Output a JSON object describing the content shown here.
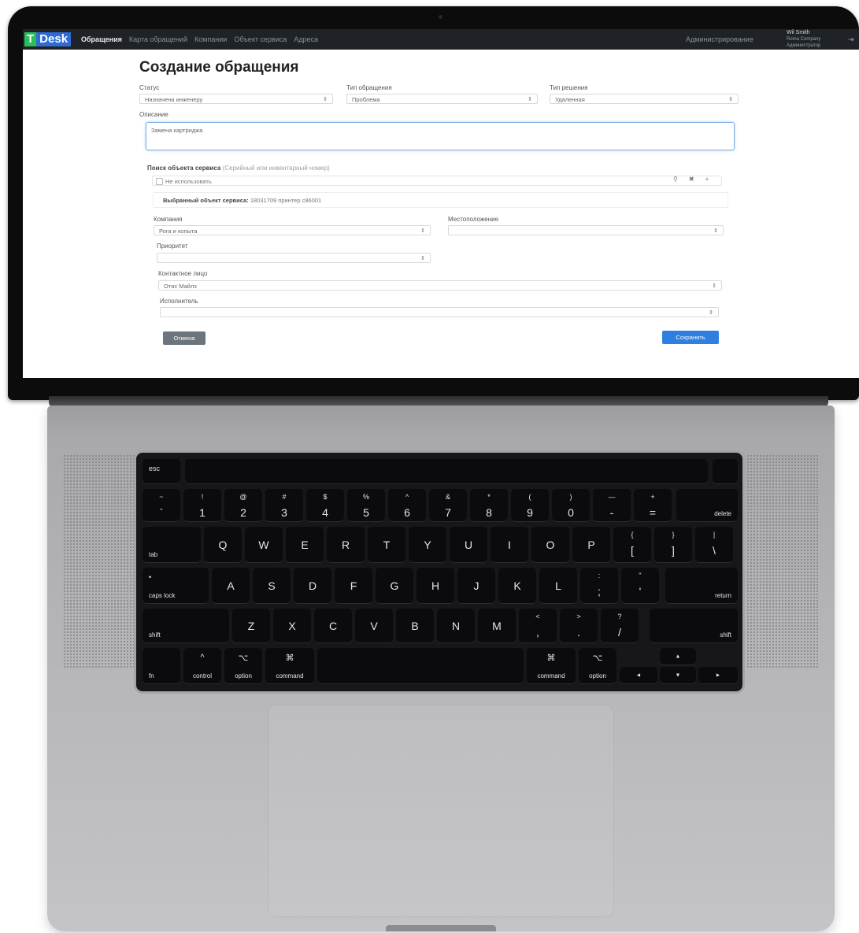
{
  "app": {
    "logo_part1": "T",
    "logo_part2": "Desk",
    "nav": [
      "Обращения",
      "Карта обращений",
      "Компании",
      "Объект сервиса",
      "Адреса"
    ],
    "admin_label": "Администрирование",
    "user_name": "Wil Smith",
    "user_company": "Roma Company",
    "user_role": "Администратор",
    "logout_icon": "logout-icon"
  },
  "form": {
    "title": "Создание обращения",
    "status": {
      "label": "Статус",
      "value": "Назначена инженеру"
    },
    "type": {
      "label": "Тип обращения",
      "value": "Проблема"
    },
    "resolution": {
      "label": "Тип решения",
      "value": "Удаленная"
    },
    "description": {
      "label": "Описание",
      "value": "Замена картриджа"
    },
    "object_search": {
      "label": "Поиск объекта сервиса",
      "hint": "(Серийный или инвентарный номер)",
      "checkbox_label": "Не использовать"
    },
    "selected_object": {
      "label": "Выбранный объект сервиса:",
      "value": "18031709 принтер c86001"
    },
    "company": {
      "label": "Компания",
      "value": "Рога и копыта"
    },
    "location": {
      "label": "Местоположение",
      "value": ""
    },
    "priority": {
      "label": "Приоритет",
      "value": ""
    },
    "contact": {
      "label": "Контактное лицо",
      "value": "Отис Майлз"
    },
    "executor": {
      "label": "Исполнитель",
      "value": ""
    },
    "cancel_label": "Отмена",
    "save_label": "Сохранить"
  },
  "keyboard": {
    "esc": "esc",
    "row1": [
      [
        "~",
        "`"
      ],
      [
        "!",
        "1"
      ],
      [
        "@",
        "2"
      ],
      [
        "#",
        "3"
      ],
      [
        "$",
        "4"
      ],
      [
        "%",
        "5"
      ],
      [
        "^",
        "6"
      ],
      [
        "&",
        "7"
      ],
      [
        "*",
        "8"
      ],
      [
        "(",
        "9"
      ],
      [
        ")",
        "0"
      ],
      [
        "—",
        "-"
      ],
      [
        "+",
        "="
      ]
    ],
    "delete": "delete",
    "tab": "tab",
    "row2": [
      "Q",
      "W",
      "E",
      "R",
      "T",
      "Y",
      "U",
      "I",
      "O",
      "P"
    ],
    "row2_br": [
      [
        "{",
        "["
      ],
      [
        "}",
        "]"
      ],
      [
        "|",
        "\\"
      ]
    ],
    "caps": "caps lock",
    "row3": [
      "A",
      "S",
      "D",
      "F",
      "G",
      "H",
      "J",
      "K",
      "L"
    ],
    "row3_p": [
      [
        ":",
        ";"
      ],
      [
        "\"",
        "'"
      ]
    ],
    "return": "return",
    "shift": "shift",
    "row4": [
      "Z",
      "X",
      "C",
      "V",
      "B",
      "N",
      "M"
    ],
    "row4_p": [
      [
        "<",
        ","
      ],
      [
        ">",
        "."
      ],
      [
        "?",
        "/"
      ]
    ],
    "fn": "fn",
    "control": "control",
    "option": "option",
    "command": "command",
    "ctrl_sym": "^",
    "opt_sym": "⌥",
    "cmd_sym": "⌘",
    "arrow_up": "▲",
    "arrow_down": "▼",
    "arrow_left": "◄",
    "arrow_right": "►"
  }
}
